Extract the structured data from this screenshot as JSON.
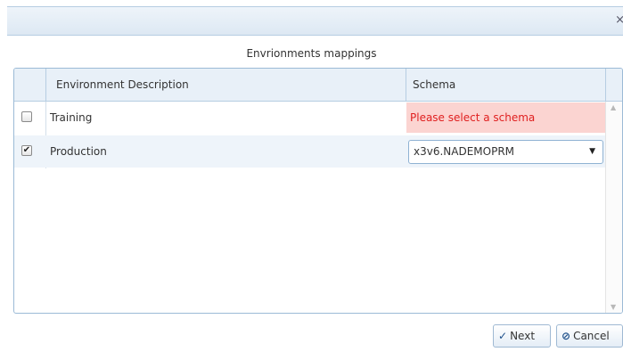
{
  "dialog": {
    "close_glyph": "×",
    "section_title": "Envrionments mappings"
  },
  "grid": {
    "columns": [
      "Environment Description",
      "Schema"
    ],
    "rows": [
      {
        "checked": false,
        "description": "Training",
        "schema": "",
        "error": "Please select a schema"
      },
      {
        "checked": true,
        "description": "Production",
        "schema": "x3v6.NADEMOPRM",
        "error": ""
      }
    ]
  },
  "buttons": {
    "next_label": "Next",
    "cancel_label": "Cancel"
  },
  "colors": {
    "header_bg": "#e8f0f8",
    "error_bg": "#fbd4d1",
    "error_text": "#e02020",
    "border": "#9bbad6"
  },
  "icons": {
    "next": "checkmark-icon",
    "cancel": "ban-icon",
    "select": "caret-down-icon"
  }
}
